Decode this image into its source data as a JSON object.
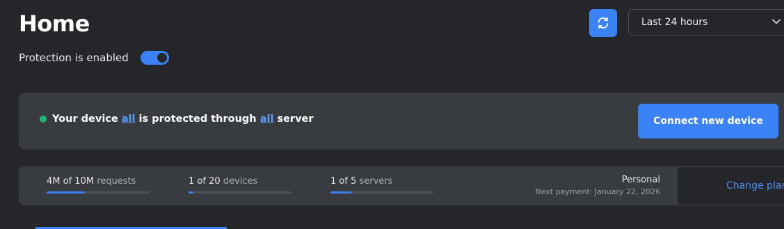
{
  "header": {
    "title": "Home",
    "protection_label": "Protection is enabled",
    "protection_enabled": true,
    "refresh_icon": "refresh-icon",
    "time_range": "Last 24 hours",
    "time_range_icon": "chevron-down-icon"
  },
  "status": {
    "prefix": "Your device ",
    "device_link": "all",
    "middle": " is protected through ",
    "server_link": "all",
    "suffix": " server",
    "dot_color": "#21b573",
    "connect_button": "Connect new device"
  },
  "usage": {
    "requests": {
      "used": "4M",
      "of": " of ",
      "total": "10M",
      "unit": " requests",
      "fraction": 0.37
    },
    "devices": {
      "used": "1",
      "of": " of ",
      "total": "20",
      "unit": " devices",
      "fraction": 0.05
    },
    "servers": {
      "used": "1",
      "of": " of ",
      "total": "5",
      "unit": " servers",
      "fraction": 0.2
    }
  },
  "plan": {
    "name": "Personal",
    "next_payment": "Next payment: January 22, 2026",
    "change_button": "Change plan"
  },
  "colors": {
    "accent": "#3a82f6",
    "background": "#24262a",
    "card": "#383b40"
  }
}
